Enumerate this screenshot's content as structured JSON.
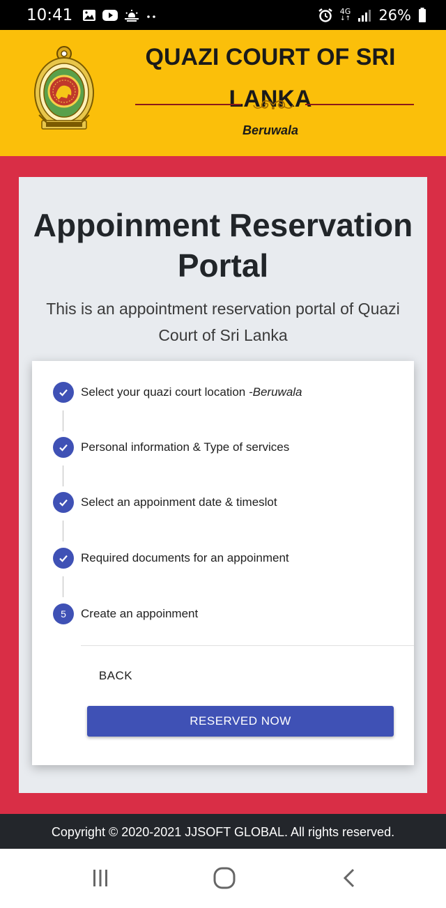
{
  "status_bar": {
    "time": "10:41",
    "network": "4G",
    "battery": "26%",
    "left_icons": [
      "gallery-icon",
      "youtube-icon",
      "weather-icon",
      "more-dots-icon"
    ],
    "right_icons": [
      "alarm-icon",
      "network-4g-icon",
      "signal-icon",
      "battery-icon"
    ]
  },
  "header": {
    "title": "QUAZI COURT OF SRI LANKA",
    "location": "Beruwala",
    "brand_color": "#fbbf0a"
  },
  "portal": {
    "title": "Appoinment Reservation Portal",
    "description": "This is an appointment reservation portal of Quazi Court of Sri Lanka"
  },
  "stepper": {
    "steps": [
      {
        "label": "Select your quazi court location ",
        "detail": "-Beruwala",
        "done": true
      },
      {
        "label": "Personal information & Type of services",
        "detail": "",
        "done": true
      },
      {
        "label": "Select an appoinment date & timeslot",
        "detail": "",
        "done": true
      },
      {
        "label": "Required documents for an appoinment",
        "detail": "",
        "done": true
      },
      {
        "label": "Create an appoinment",
        "detail": "",
        "done": false,
        "number": "5"
      }
    ],
    "back_label": "BACK",
    "reserve_label": "RESERVED NOW",
    "accent_color": "#3f51b5"
  },
  "footer": {
    "copyright": "Copyright © 2020-2021 JJSOFT GLOBAL. All rights reserved."
  },
  "colors": {
    "background_red": "#d92e46",
    "card": "#e8ebef",
    "footer": "#23262b"
  }
}
